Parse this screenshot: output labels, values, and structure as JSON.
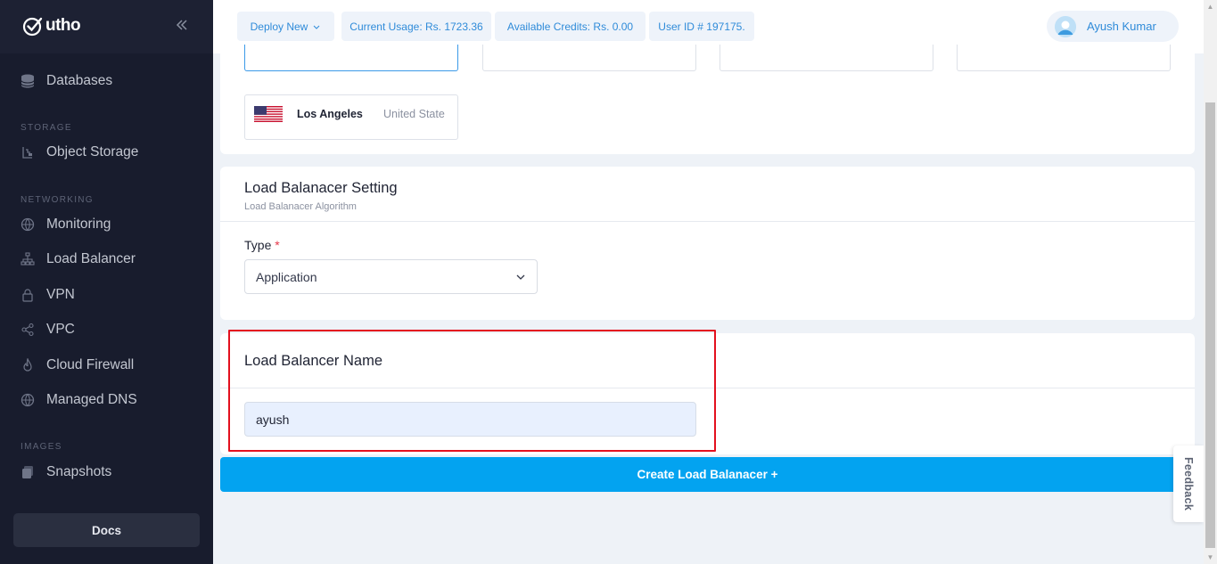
{
  "brand": {
    "name": "utho"
  },
  "sidebar": {
    "items_top": [
      {
        "label": "Databases",
        "icon": "database-icon"
      }
    ],
    "sections": [
      {
        "title": "STORAGE",
        "items": [
          {
            "label": "Object Storage",
            "icon": "object-storage-icon"
          }
        ]
      },
      {
        "title": "NETWORKING",
        "items": [
          {
            "label": "Monitoring",
            "icon": "globe-icon"
          },
          {
            "label": "Load Balancer",
            "icon": "sitemap-icon"
          },
          {
            "label": "VPN",
            "icon": "lock-icon"
          },
          {
            "label": "VPC",
            "icon": "share-icon"
          },
          {
            "label": "Cloud Firewall",
            "icon": "fire-icon"
          },
          {
            "label": "Managed DNS",
            "icon": "globe-icon"
          }
        ]
      },
      {
        "title": "IMAGES",
        "items": [
          {
            "label": "Snapshots",
            "icon": "snapshot-icon"
          }
        ]
      }
    ],
    "docs_label": "Docs"
  },
  "topbar": {
    "deploy_label": "Deploy New",
    "usage": "Current Usage: Rs. 1723.36",
    "credits": "Available Credits: Rs. 0.00",
    "user_id": "User ID # 197175.",
    "user_name": "Ayush Kumar"
  },
  "location": {
    "city": "Los Angeles",
    "country": "United State"
  },
  "lb_setting": {
    "title": "Load Balanacer Setting",
    "subtitle": "Load Balanacer Algorithm",
    "type_label": "Type",
    "required_mark": "*",
    "type_value": "Application"
  },
  "lb_name": {
    "title": "Load Balancer Name",
    "value": "ayush"
  },
  "create_button": "Create Load Balanacer +",
  "feedback_label": "Feedback",
  "colors": {
    "accent": "#03a3f0",
    "sidebar": "#181c2d",
    "highlight": "#e3101e"
  }
}
